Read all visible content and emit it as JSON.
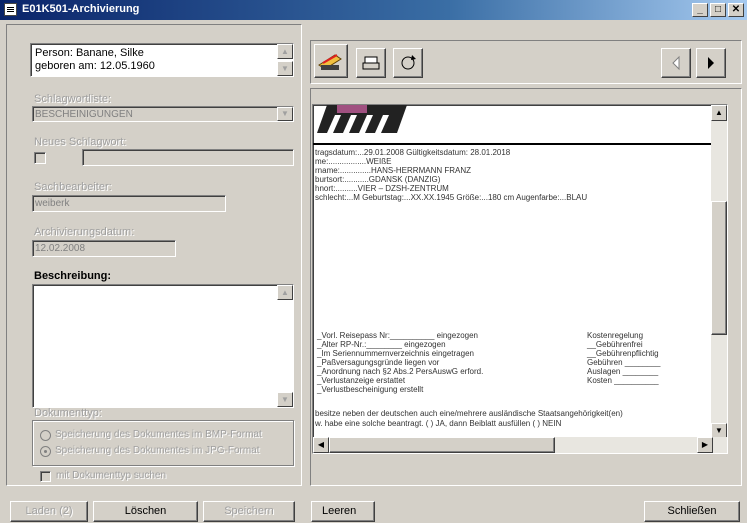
{
  "window": {
    "title": "E01K501-Archivierung"
  },
  "person": {
    "line1": "Person: Banane, Silke",
    "line2": "geboren am: 12.05.1960"
  },
  "form": {
    "schlagwortliste_label": "Schlagwortliste:",
    "schlagwortliste_value": "BESCHEINIGUNGEN",
    "neues_schlagwort_label": "Neues Schlagwort:",
    "sachbearbeiter_label": "Sachbearbeiter:",
    "sachbearbeiter_value": "weiberk",
    "archivierungsdatum_label": "Archivierungsdatum:",
    "archivierungsdatum_value": "12.02.2008",
    "beschreibung_label": "Beschreibung:",
    "dokumenttyp_label": "Dokumenttyp:",
    "radio_bmp": "Speicherung des Dokumentes im BMP-Format",
    "radio_jpg": "Speicherung des Dokumentes im JPG-Format",
    "mit_dokumenttyp": "mit Dokumenttyp suchen"
  },
  "buttons": {
    "laden": "Laden (2)",
    "loeschen": "Löschen",
    "speichern": "Speichern",
    "leeren": "Leeren",
    "schliessen": "Schließen"
  },
  "document": {
    "lines_top": [
      "tragsdatum:...29.01.2008      Gültigkeitsdatum: 28.01.2018",
      "me:.................WEIßE",
      "rname:..............HANS-HERRMANN FRANZ",
      "burtsort:...........GDANSK (DANZIG)",
      "hnort:..........VIER – DZSH-ZENTRUM",
      "schlecht:...M  Geburtstag:...XX.XX.1945  Größe:...180 cm  Augenfarbe:...BLAU"
    ],
    "lines_left": [
      "_Vorl. Reisepass Nr:__________ eingezogen",
      "_Alter RP-Nr.:________ eingezogen",
      "_Im Seriennummernverzeichnis eingetragen",
      "_Paßversagungsgründe liegen vor",
      "_Anordnung nach §2 Abs.2 PersAuswG erford.",
      "_Verlustanzeige erstattet",
      "_Verlustbescheinigung erstellt"
    ],
    "lines_right": [
      "Kostenregelung",
      "__Gebührenfrei",
      "__Gebührenpflichtig",
      "Gebühren ________",
      "Auslagen ________",
      "Kosten __________"
    ],
    "lines_bottom": [
      "besitze neben der deutschen auch eine/mehrere ausländische Staatsangehörigkeit(en)",
      "w. habe eine solche beantragt.   (  ) JA, dann Beiblatt ausfüllen     (  ) NEIN"
    ]
  }
}
